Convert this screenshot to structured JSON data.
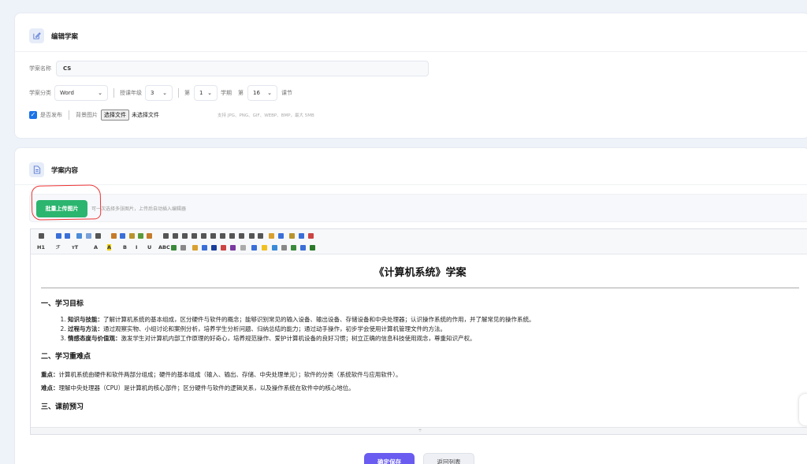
{
  "edit_card": {
    "title": "编辑学案",
    "icon": "edit-icon"
  },
  "name_field": {
    "label": "学案名称",
    "value": "CS"
  },
  "classify": {
    "category_label": "学案分类",
    "category_value": "Word",
    "grade_label": "授课年级",
    "grade_value": "3",
    "term_prefix": "第",
    "term_value": "1",
    "term_suffix": "学期",
    "lesson_prefix": "第",
    "lesson_value": "16",
    "lesson_suffix": "课节"
  },
  "publish": {
    "label": "是否发布",
    "checked": true,
    "bg_label": "背景图片",
    "file_button": "选择文件",
    "file_status": "未选择文件",
    "hint": "支持 JPG、PNG、GIF、WEBP、BMP，最大 5MB"
  },
  "content_card": {
    "title": "学案内容",
    "icon": "document-icon"
  },
  "batch": {
    "button": "批量上传图片",
    "tip": "可一次选择多张图片，上传后自动插入编辑器"
  },
  "toolbar": {
    "row2_labels": [
      "H1",
      "ℱ",
      "тT",
      "A",
      "A",
      "B",
      "I",
      "U",
      "ABC"
    ]
  },
  "doc": {
    "title": "《计算机系统》学案",
    "s1": "一、学习目标",
    "items": [
      {
        "bold": "知识与技能：",
        "text": "了解计算机系统的基本组成，区分硬件与软件的概念；能够识别常见的输入设备、输出设备、存储设备和中央处理器；认识操作系统的作用，并了解常见的操作系统。"
      },
      {
        "bold": "过程与方法：",
        "text": "通过观察实物、小组讨论和案例分析，培养学生分析问题、归纳总结的能力；通过动手操作，初步学会使用计算机管理文件的方法。"
      },
      {
        "bold": "情感态度与价值观：",
        "text": "激发学生对计算机内部工作原理的好奇心，培养规范操作、爱护计算机设备的良好习惯；树立正确的信息科技使用观念，尊重知识产权。"
      }
    ],
    "s2": "二、学习重难点",
    "key_bold": "重点：",
    "key_text": "计算机系统由硬件和软件两部分组成；硬件的基本组成（输入、输出、存储、中央处理单元）；软件的分类（系统软件与应用软件）。",
    "diff_bold": "难点：",
    "diff_text": "理解中央处理器（CPU）是计算机的核心部件；区分硬件与软件的逻辑关系，以及操作系统在软件中的核心地位。",
    "s3": "三、课前预习"
  },
  "actions": {
    "save": "确定保存",
    "back": "返回列表"
  },
  "colors": {
    "primary": "#6a5cf0",
    "green": "#2bb56e",
    "annotation": "#e33333"
  }
}
